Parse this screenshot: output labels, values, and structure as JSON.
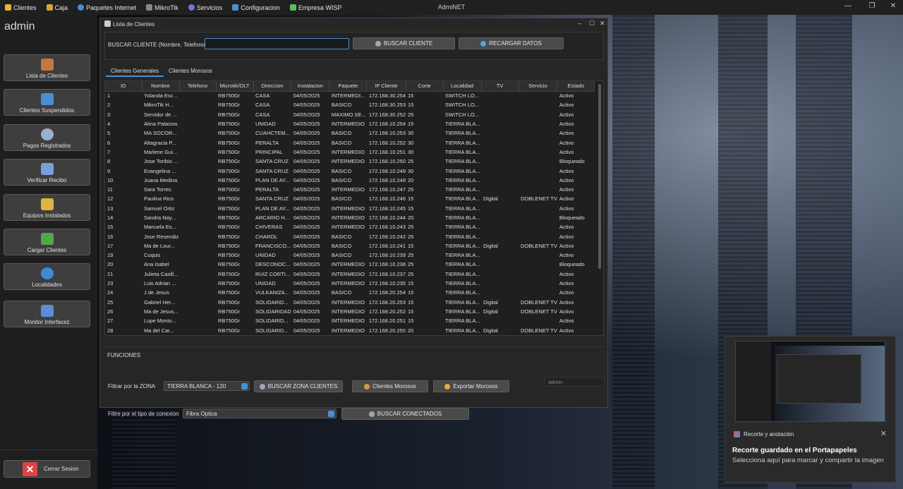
{
  "menubar": {
    "items": [
      {
        "label": "Clientes",
        "icon": "users-icon",
        "color": "#e8b33a"
      },
      {
        "label": "Caja",
        "icon": "cash-icon",
        "color": "#d8a53a"
      },
      {
        "label": "Paquetes Internet",
        "icon": "globe-icon",
        "color": "#4a8fd6"
      },
      {
        "label": "MikroTik",
        "icon": "router-icon",
        "color": "#888888"
      },
      {
        "label": "Servicios",
        "icon": "services-icon",
        "color": "#6c7ad8"
      },
      {
        "label": "Configuracion",
        "icon": "config-icon",
        "color": "#4a8fd6"
      },
      {
        "label": "Empresa WISP",
        "icon": "company-icon",
        "color": "#5cbf5c"
      }
    ],
    "title": "AdmiNET",
    "controls": [
      "—",
      "❐",
      "✕"
    ]
  },
  "sidebar": {
    "user": "admin",
    "buttons": [
      {
        "label": "Lista de Clientes",
        "icon": "users-icon",
        "color": "#c7773a"
      },
      {
        "label": "Clientes Suspendidos",
        "icon": "suspended-user-icon",
        "color": "#4a8fd6"
      },
      {
        "label": "Pagos Registrados",
        "icon": "clock-icon",
        "color": "#9ab0d0"
      },
      {
        "label": "Verificar Recibo",
        "icon": "receipt-icon",
        "color": "#7aa0d8"
      },
      {
        "label": "Equipos Instalados",
        "icon": "equipment-icon",
        "color": "#e0b440"
      },
      {
        "label": "Cargar Clientes",
        "icon": "check-icon",
        "color": "#4fa84f"
      },
      {
        "label": "Localidades",
        "icon": "globe-icon",
        "color": "#3d8ad6"
      },
      {
        "label": "Monitor Interfacez",
        "icon": "monitor-icon",
        "color": "#5a8fd6"
      }
    ],
    "logout": "Cerrar Sesion"
  },
  "dialog": {
    "title": "Lista de Clientes",
    "controls": [
      "–",
      "☐",
      "✕"
    ],
    "search": {
      "label": "BUSCAR CLIENTE (Nombre, Telefono)",
      "value": "",
      "placeholder": "",
      "search_button": "BUSCAR CLIENTE",
      "reload_button": "RECARGAR DATOS"
    },
    "tabs": [
      "Clientes Generales",
      "Clientes Morosos"
    ],
    "table": {
      "columns": [
        "ID",
        "Nombre",
        "Telefono",
        "Microtik/OLT",
        "Direccion",
        "Instalacion",
        "Paquete",
        "IP Cliente",
        "Corte",
        "Localidad",
        "TV",
        "Servicio",
        "Estado"
      ],
      "rows": [
        [
          "1",
          "Yolanda Esc...",
          "",
          "RB750Gr",
          "CASA",
          "04/05/2025",
          "INTERMEDI...",
          "172.168.30.254",
          "15",
          "SWITCH LO...",
          "",
          "",
          "Activo"
        ],
        [
          "2",
          "MikroTik H...",
          "",
          "RB750Gr",
          "CASA",
          "04/05/2025",
          "BASICO",
          "172.168.30.253",
          "15",
          "SWITCH LO...",
          "",
          "",
          "Activo"
        ],
        [
          "3",
          "Servidor de ...",
          "",
          "RB750Gr",
          "CASA",
          "04/05/2025",
          "MAXIMO SE...",
          "172.168.30.252",
          "25",
          "SWITCH LO...",
          "",
          "",
          "Activo"
        ],
        [
          "4",
          "Alma Palacios",
          "",
          "RB750Gr",
          "UNIDAD",
          "04/05/2025",
          "INTERMEDIO",
          "172.168.10.254",
          "15",
          "TIERRA BLA...",
          "",
          "",
          "Activo"
        ],
        [
          "5",
          "MA SOCOR...",
          "",
          "RB750Gr",
          "CUAHCTEM...",
          "04/05/2025",
          "BASICO",
          "172.168.10.253",
          "30",
          "TIERRA BLA...",
          "",
          "",
          "Activo"
        ],
        [
          "6",
          "Altagracia P...",
          "",
          "RB750Gr",
          "PERALTA",
          "04/05/2025",
          "BASICO",
          "172.168.10.252",
          "30",
          "TIERRA BLA...",
          "",
          "",
          "Activo"
        ],
        [
          "7",
          "Marlene Gui...",
          "",
          "RB750Gr",
          "PRINCIPAL",
          "04/05/2025",
          "INTERMEDIO",
          "172.168.10.251",
          "30",
          "TIERRA BLA...",
          "",
          "",
          "Activo"
        ],
        [
          "8",
          "Jose Toribio ...",
          "",
          "RB750Gr",
          "SANTA CRUZ",
          "04/05/2025",
          "INTERMEDIO",
          "172.168.10.250",
          "25",
          "TIERRA BLA...",
          "",
          "",
          "Bloqueado"
        ],
        [
          "9",
          "Evangelina ...",
          "",
          "RB750Gr",
          "SANTA CRUZ",
          "04/05/2025",
          "BASICO",
          "172.168.10.249",
          "30",
          "TIERRA BLA...",
          "",
          "",
          "Activo"
        ],
        [
          "10",
          "Juana Medina",
          "",
          "RB750Gr",
          "PLAN DE AY...",
          "04/05/2025",
          "BASICO",
          "172.168.10.248",
          "20",
          "TIERRA BLA...",
          "",
          "",
          "Activo"
        ],
        [
          "11",
          "Sara Torres",
          "",
          "RB750Gr",
          "PERALTA",
          "04/05/2025",
          "INTERMEDIO",
          "172.168.10.247",
          "25",
          "TIERRA BLA...",
          "",
          "",
          "Activo"
        ],
        [
          "12",
          "Paulina Rico",
          "",
          "RB750Gr",
          "SANTA CRUZ",
          "04/05/2025",
          "BASICO",
          "172.168.10.246",
          "15",
          "TIERRA BLA...",
          "Digital",
          "DOBLENET TV",
          "Activo"
        ],
        [
          "13",
          "Samuel Ortiz",
          "",
          "RB750Gr",
          "PLAN DE AY...",
          "04/05/2025",
          "INTERMEDIO",
          "172.168.10.245",
          "15",
          "TIERRA BLA...",
          "",
          "",
          "Activo"
        ],
        [
          "14",
          "Sandra Nay...",
          "",
          "RB750Gr",
          "ARCARIO H...",
          "04/05/2025",
          "INTERMEDIO",
          "172.168.10.244",
          "20",
          "TIERRA BLA...",
          "",
          "",
          "Bloqueado"
        ],
        [
          "15",
          "Manuela Es...",
          "",
          "RB750Gr",
          "CHIVERAS",
          "04/05/2025",
          "INTERMEDIO",
          "172.168.10.243",
          "25",
          "TIERRA BLA...",
          "",
          "",
          "Activo"
        ],
        [
          "16",
          "Jose Resendiz",
          "",
          "RB750Gr",
          "CHAROL",
          "04/05/2025",
          "BASICO",
          "172.168.10.242",
          "25",
          "TIERRA BLA...",
          "",
          "",
          "Activo"
        ],
        [
          "17",
          "Ma de Lour...",
          "",
          "RB750Gr",
          "FRANCISCO...",
          "04/05/2025",
          "BASICO",
          "172.168.10.241",
          "15",
          "TIERRA BLA...",
          "Digital",
          "DOBLENET TV",
          "Activo"
        ],
        [
          "19",
          "Cuquis",
          "",
          "RB750Gr",
          "UNIDAD",
          "04/05/2025",
          "BASICO",
          "172.168.10.239",
          "25",
          "TIERRA BLA...",
          "",
          "",
          "Activo"
        ],
        [
          "20",
          "Ana Isabel",
          "",
          "RB750Gr",
          "DESCONOC...",
          "04/05/2025",
          "INTERMEDIO",
          "172.168.10.238",
          "25",
          "TIERRA BLA...",
          "",
          "",
          "Bloqueado"
        ],
        [
          "21",
          "Julieta Casill...",
          "",
          "RB750Gr",
          "RUIZ CORTI...",
          "04/05/2025",
          "INTERMEDIO",
          "172.168.10.237",
          "25",
          "TIERRA BLA...",
          "",
          "",
          "Activo"
        ],
        [
          "23",
          "Luis Adrian ...",
          "",
          "RB750Gr",
          "UNIDAD",
          "04/05/2025",
          "INTERMEDIO",
          "172.168.10.235",
          "15",
          "TIERRA BLA...",
          "",
          "",
          "Activo"
        ],
        [
          "24",
          "J de Jesus",
          "",
          "RB750Gr",
          "VULKANIZA...",
          "04/05/2025",
          "BASICO",
          "172.168.20.254",
          "15",
          "TIERRA BLA...",
          "",
          "",
          "Activo"
        ],
        [
          "25",
          "Gabriel Her...",
          "",
          "RB750Gr",
          "SOLIDARID...",
          "04/05/2025",
          "INTERMEDIO",
          "172.168.20.253",
          "15",
          "TIERRA BLA...",
          "Digital",
          "DOBLENET TV",
          "Activo"
        ],
        [
          "26",
          "Ma de Jesus...",
          "",
          "RB750Gr",
          "SOLIDARIDAD",
          "04/05/2025",
          "INTERMEDIO",
          "172.168.20.252",
          "15",
          "TIERRA BLA...",
          "Digital",
          "DOBLENET TV",
          "Activo"
        ],
        [
          "27",
          "Lupe Monto...",
          "",
          "RB750Gr",
          "SOLIDARID...",
          "04/05/2025",
          "INTERMEDIO",
          "172.168.20.251",
          "15",
          "TIERRA BLA...",
          "",
          "",
          "Activo"
        ],
        [
          "28",
          "Ma del Car...",
          "",
          "RB750Gr",
          "SOLIDARID...",
          "04/05/2025",
          "INTERMEDIO",
          "172.168.20.250",
          "20",
          "TIERRA BLA...",
          "Digital",
          "DOBLENET TV",
          "Activo"
        ]
      ]
    },
    "functions": {
      "section_label": "FUNCIONES",
      "zone_label": "Filtrar por la ZONA",
      "zone_value": "TIERRA BLANCA - 120",
      "zone_button": "BUSCAR ZONA CLIENTES",
      "morosos_button": "Clientes Morosos",
      "export_button": "Exportar Morosos",
      "user_field": "admin",
      "conn_label": "Filtre por el tipo de conexion",
      "conn_value": "Fibra Optica",
      "conn_button": "BUSCAR CONECTADOS"
    }
  },
  "toast": {
    "app": "Recorte y anotación",
    "title": "Recorte guardado en el Portapapeles",
    "message": "Selecciona aquí para marcar y compartir la imagen",
    "close": "✕"
  },
  "colors": {
    "accent": "#4a8fd6",
    "background": "#262626"
  }
}
